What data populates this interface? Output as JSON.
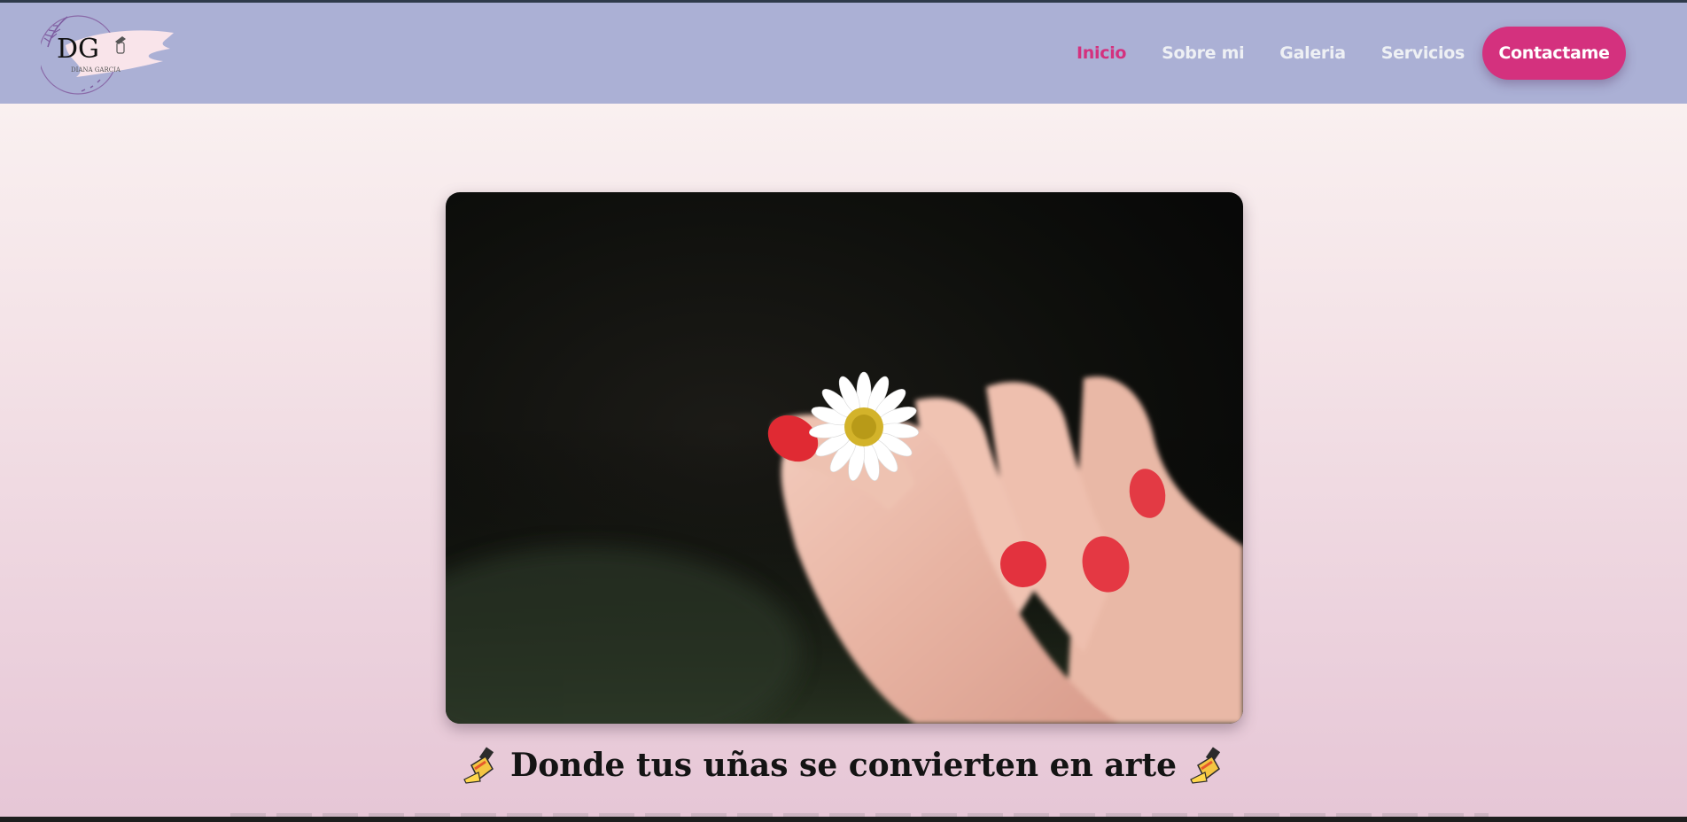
{
  "brand": {
    "logo_initials": "DG",
    "logo_name": "DIANA GARCIA"
  },
  "nav": {
    "items": [
      {
        "label": "Inicio",
        "active": true
      },
      {
        "label": "Sobre mi",
        "active": false
      },
      {
        "label": "Galeria",
        "active": false
      },
      {
        "label": "Servicios",
        "active": false
      }
    ],
    "cta_label": "Contactame"
  },
  "hero": {
    "image_icon": "hand-daisy-photo",
    "headline": "Donde tus uñas se convierten en arte",
    "headline_icon": "nail-polish-icon"
  },
  "colors": {
    "header_bg": "#abb0d5",
    "accent": "#d4317e",
    "nav_text": "#eef0f4"
  }
}
